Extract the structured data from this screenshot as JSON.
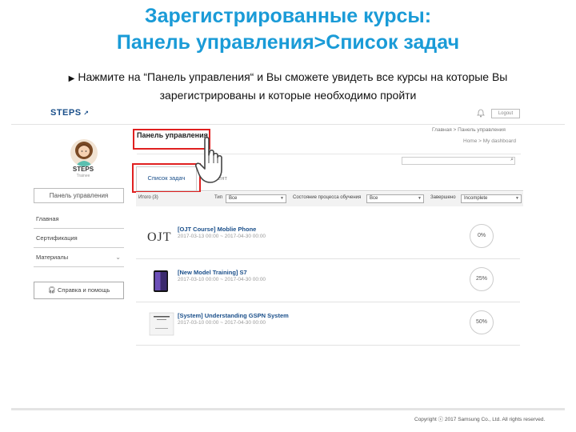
{
  "slide": {
    "title_line1": "Зарегистрированные курсы:",
    "title_line2": "Панель управления>Список задач",
    "bullet_line1": "Нажмите на “Панель управления“ и Вы сможете увидеть все курсы на которые Вы",
    "bullet_line2": "зарегистрированы и которые необходимо пройти"
  },
  "app": {
    "logo": "STEPS",
    "logout": "Logout",
    "breadcrumb_ru": "Главная  >  Панель управления",
    "breadcrumb_en": "Home  >  My dashboard"
  },
  "sidebar": {
    "user_name": "STEPS",
    "user_role": "Trainee",
    "dashboard_button": "Панель управления",
    "items": [
      {
        "label": "Главная"
      },
      {
        "label": "Сертификация"
      },
      {
        "label": "Материалы"
      }
    ],
    "help_button": "Справка и помощь"
  },
  "main": {
    "page_title": "Панель управления",
    "tabs": [
      {
        "label": "Список задач"
      },
      {
        "label": "Контент"
      }
    ],
    "filters": {
      "total_label": "Итого (3)",
      "type_label": "Тип",
      "type_value": "Все",
      "status_label": "Состояние процесса обучения",
      "status_value": "Все",
      "completed_label": "Завершено",
      "completed_value": "Incomplete"
    },
    "courses": [
      {
        "title": "[OJT Course] Moblie Phone",
        "dates": "2017-03-13 00:00 ~ 2017-04-30 00:00",
        "progress": "0%"
      },
      {
        "title": "[New Model Training] S7",
        "dates": "2017-03-10 00:00 ~ 2017-04-30 00:00",
        "progress": "25%"
      },
      {
        "title": "[System] Understanding GSPN System",
        "dates": "2017-03-10 00:00 ~ 2017-04-30 00:00",
        "progress": "50%"
      }
    ],
    "thumb_ojt_text": "OJT"
  },
  "footer": {
    "copyright": "Copyright ⓒ 2017 Samsung Co., Ltd. All rights reserved."
  },
  "colors": {
    "title": "#1a9bd7",
    "highlight": "#e02020",
    "link": "#1a4f8a"
  }
}
